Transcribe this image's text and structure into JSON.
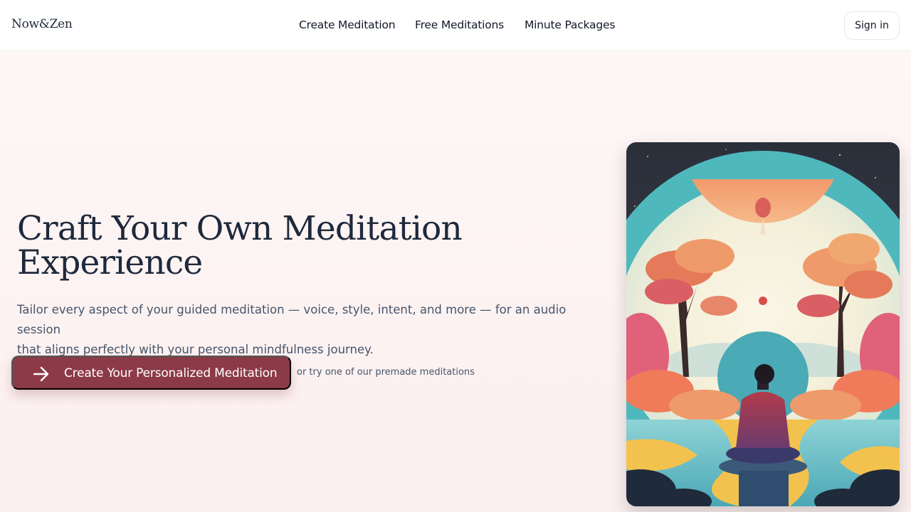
{
  "header": {
    "logo": "Now&Zen",
    "nav": [
      {
        "label": "Create Meditation"
      },
      {
        "label": "Free Meditations"
      },
      {
        "label": "Minute Packages"
      }
    ],
    "signin_label": "Sign in"
  },
  "hero": {
    "headline_line1": "Craft Your Own Meditation",
    "headline_line2": "Experience",
    "subtext_line1": "Tailor every aspect of your guided meditation — voice, style, intent, and more — for an audio session",
    "subtext_line2": "that aligns perfectly with your personal mindfulness journey.",
    "cta_label": "Create Your Personalized Meditation",
    "cta_icon": "arrow-right-icon",
    "premade_text": "or try one of our premade meditations"
  },
  "illustration": {
    "subject": "person-meditating-illustration"
  },
  "colors": {
    "accent": "#8c3a48",
    "heading": "#1e293b",
    "body_text": "#475569",
    "background": "#fdf4f4"
  }
}
